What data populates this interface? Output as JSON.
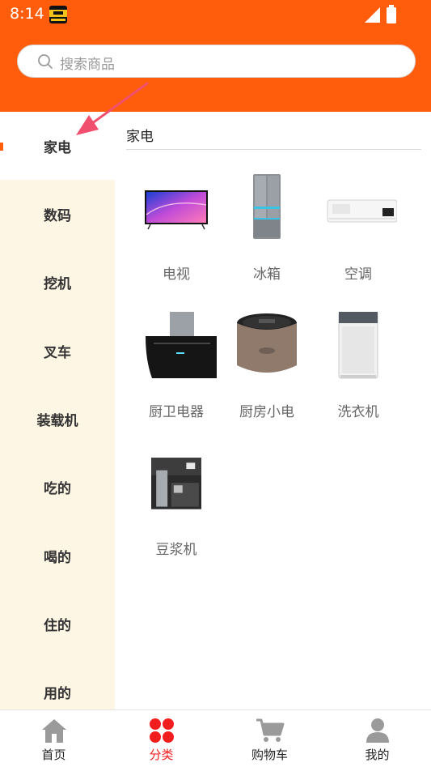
{
  "status_bar": {
    "time": "8:14"
  },
  "search": {
    "placeholder": "搜索商品"
  },
  "sidebar": {
    "items": [
      {
        "label": "家电",
        "active": true
      },
      {
        "label": "数码",
        "active": false
      },
      {
        "label": "挖机",
        "active": false
      },
      {
        "label": "叉车",
        "active": false
      },
      {
        "label": "装载机",
        "active": false
      },
      {
        "label": "吃的",
        "active": false
      },
      {
        "label": "喝的",
        "active": false
      },
      {
        "label": "住的",
        "active": false
      },
      {
        "label": "用的",
        "active": false
      }
    ]
  },
  "content": {
    "section_title": "家电",
    "products": [
      {
        "label": "电视",
        "icon": "tv-image"
      },
      {
        "label": "冰箱",
        "icon": "fridge-image"
      },
      {
        "label": "空调",
        "icon": "air-conditioner-image"
      },
      {
        "label": "厨卫电器",
        "icon": "range-hood-image"
      },
      {
        "label": "厨房小电",
        "icon": "rice-cooker-image"
      },
      {
        "label": "洗衣机",
        "icon": "washing-machine-image"
      },
      {
        "label": "豆浆机",
        "icon": "kitchen-scene-image"
      }
    ]
  },
  "bottom_nav": {
    "items": [
      {
        "label": "首页",
        "icon": "home-icon",
        "active": false
      },
      {
        "label": "分类",
        "icon": "category-icon",
        "active": true
      },
      {
        "label": "购物车",
        "icon": "cart-icon",
        "active": false
      },
      {
        "label": "我的",
        "icon": "profile-icon",
        "active": false
      }
    ]
  },
  "colors": {
    "header": "#ff5c0b",
    "sidebar_bg": "#fdf6e5",
    "active_nav": "#f21d1d",
    "annotation_arrow": "#f0506e"
  }
}
